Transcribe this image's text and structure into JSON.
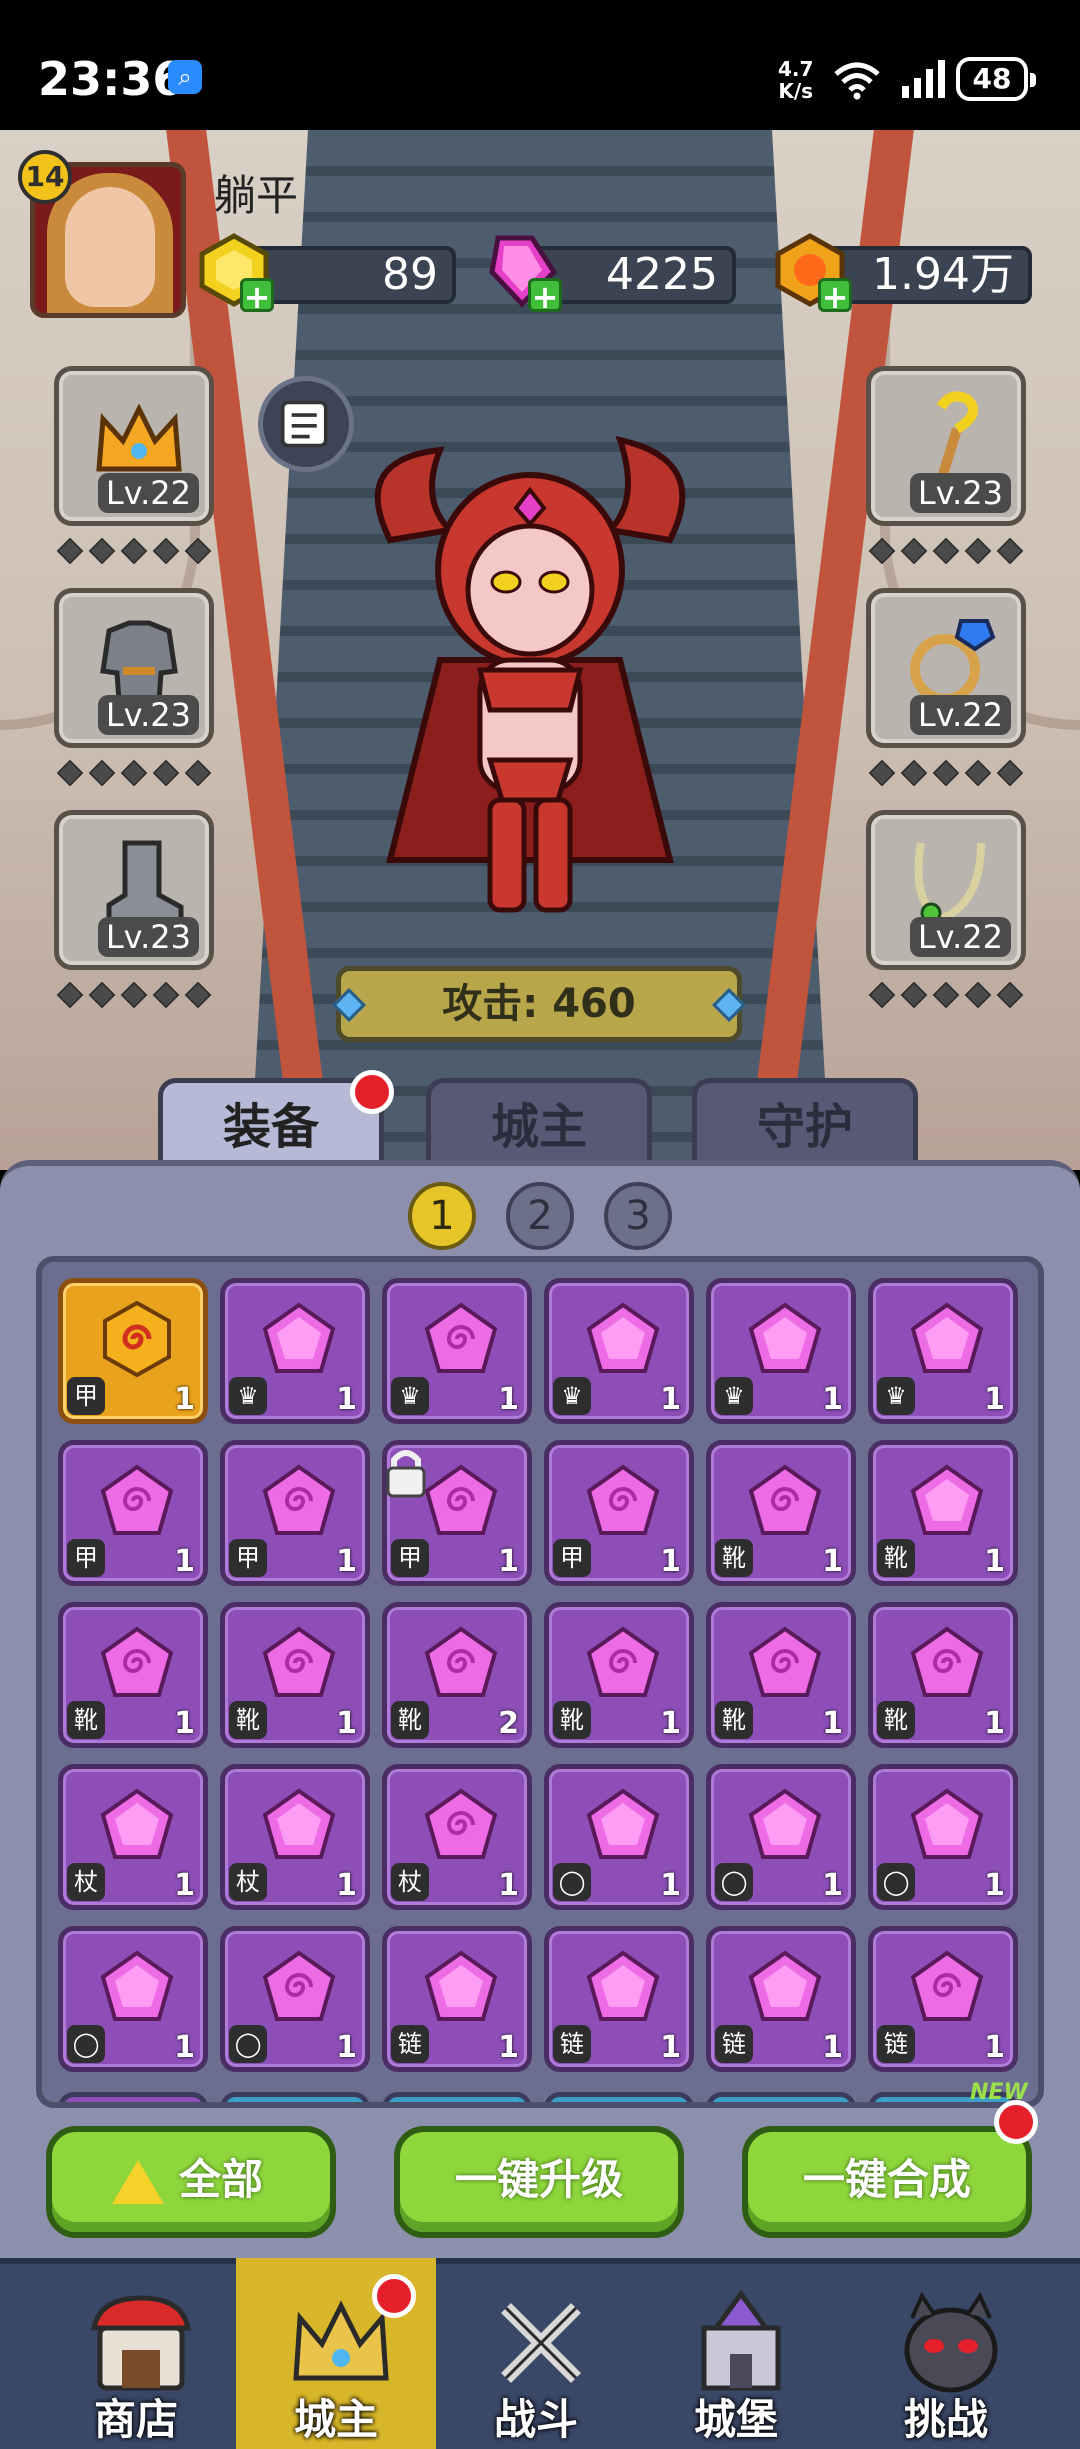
{
  "status_bar": {
    "time": "23:36",
    "net_speed_value": "4.7",
    "net_speed_unit": "K/s",
    "battery": "48"
  },
  "player": {
    "name": "躺平",
    "level": "14",
    "currency": {
      "gold_bars": "89",
      "gems": "4225",
      "coins": "1.94万"
    }
  },
  "equipment": {
    "left": [
      {
        "label": "Lv.22",
        "icon": "crown-icon"
      },
      {
        "label": "Lv.23",
        "icon": "armor-icon"
      },
      {
        "label": "Lv.23",
        "icon": "boots-icon"
      }
    ],
    "right": [
      {
        "label": "Lv.23",
        "icon": "staff-icon"
      },
      {
        "label": "Lv.22",
        "icon": "ring-icon"
      },
      {
        "label": "Lv.22",
        "icon": "necklace-icon"
      }
    ],
    "stars_per_slot": 5
  },
  "attack": {
    "text": "攻击: 460"
  },
  "tabs": [
    {
      "label": "装备",
      "active": true,
      "notification": true
    },
    {
      "label": "城主",
      "active": false
    },
    {
      "label": "守护",
      "active": false
    }
  ],
  "pages": [
    {
      "label": "1",
      "active": true
    },
    {
      "label": "2",
      "active": false
    },
    {
      "label": "3",
      "active": false
    }
  ],
  "inventory": [
    [
      {
        "color": "orange",
        "gem": "spiral",
        "slot": "armor",
        "count": "1"
      },
      {
        "color": "purple",
        "gem": "plain",
        "slot": "crown",
        "count": "1"
      },
      {
        "color": "purple",
        "gem": "spiral",
        "slot": "crown",
        "count": "1"
      },
      {
        "color": "purple",
        "gem": "plain",
        "slot": "crown",
        "count": "1"
      },
      {
        "color": "purple",
        "gem": "plain",
        "slot": "crown",
        "count": "1"
      },
      {
        "color": "purple",
        "gem": "plain",
        "slot": "crown",
        "count": "1"
      }
    ],
    [
      {
        "color": "purple",
        "gem": "spiral",
        "slot": "armor",
        "count": "1"
      },
      {
        "color": "purple",
        "gem": "spiral",
        "slot": "armor",
        "count": "1"
      },
      {
        "color": "purple",
        "gem": "spiral",
        "slot": "armor",
        "count": "1",
        "locked": true
      },
      {
        "color": "purple",
        "gem": "spiral",
        "slot": "armor",
        "count": "1"
      },
      {
        "color": "purple",
        "gem": "spiral",
        "slot": "boots",
        "count": "1"
      },
      {
        "color": "purple",
        "gem": "plain",
        "slot": "boots",
        "count": "1"
      }
    ],
    [
      {
        "color": "purple",
        "gem": "spiral",
        "slot": "boots",
        "count": "1"
      },
      {
        "color": "purple",
        "gem": "spiral",
        "slot": "boots",
        "count": "1"
      },
      {
        "color": "purple",
        "gem": "spiral",
        "slot": "boots",
        "count": "2"
      },
      {
        "color": "purple",
        "gem": "spiral",
        "slot": "boots",
        "count": "1"
      },
      {
        "color": "purple",
        "gem": "spiral",
        "slot": "boots",
        "count": "1"
      },
      {
        "color": "purple",
        "gem": "spiral",
        "slot": "boots",
        "count": "1"
      }
    ],
    [
      {
        "color": "purple",
        "gem": "plain",
        "slot": "staff",
        "count": "1"
      },
      {
        "color": "purple",
        "gem": "plain",
        "slot": "staff",
        "count": "1"
      },
      {
        "color": "purple",
        "gem": "spiral",
        "slot": "staff",
        "count": "1"
      },
      {
        "color": "purple",
        "gem": "plain",
        "slot": "ring",
        "count": "1"
      },
      {
        "color": "purple",
        "gem": "plain",
        "slot": "ring",
        "count": "1"
      },
      {
        "color": "purple",
        "gem": "plain",
        "slot": "ring",
        "count": "1"
      }
    ],
    [
      {
        "color": "purple",
        "gem": "plain",
        "slot": "ring",
        "count": "1"
      },
      {
        "color": "purple",
        "gem": "spiral",
        "slot": "ring",
        "count": "1"
      },
      {
        "color": "purple",
        "gem": "plain",
        "slot": "necklace",
        "count": "1"
      },
      {
        "color": "purple",
        "gem": "plain",
        "slot": "necklace",
        "count": "1"
      },
      {
        "color": "purple",
        "gem": "plain",
        "slot": "necklace",
        "count": "1"
      },
      {
        "color": "purple",
        "gem": "spiral",
        "slot": "necklace",
        "count": "1"
      }
    ]
  ],
  "slot_glyphs": {
    "armor": "甲",
    "crown": "♛",
    "boots": "靴",
    "staff": "杖",
    "ring": "◯",
    "necklace": "链"
  },
  "actions": {
    "all_label": "全部",
    "upgrade_label": "一键升级",
    "merge_label": "一键合成",
    "new_tag": "NEW"
  },
  "nav": [
    {
      "label": "商店",
      "icon": "shop-icon",
      "active": false
    },
    {
      "label": "城主",
      "icon": "crown-icon",
      "active": true,
      "notification": true
    },
    {
      "label": "战斗",
      "icon": "swords-icon",
      "active": false
    },
    {
      "label": "城堡",
      "icon": "castle-icon",
      "active": false
    },
    {
      "label": "挑战",
      "icon": "monster-icon",
      "active": false
    }
  ],
  "colors": {
    "panel": "#8c90ad",
    "cell_purple": "#8d4fb7",
    "cell_orange": "#e9a21d",
    "gem_pink": "#ee6be6",
    "button_green": "#8fd63c",
    "nav_active": "#d8b62a",
    "notification_red": "#e5202a"
  }
}
